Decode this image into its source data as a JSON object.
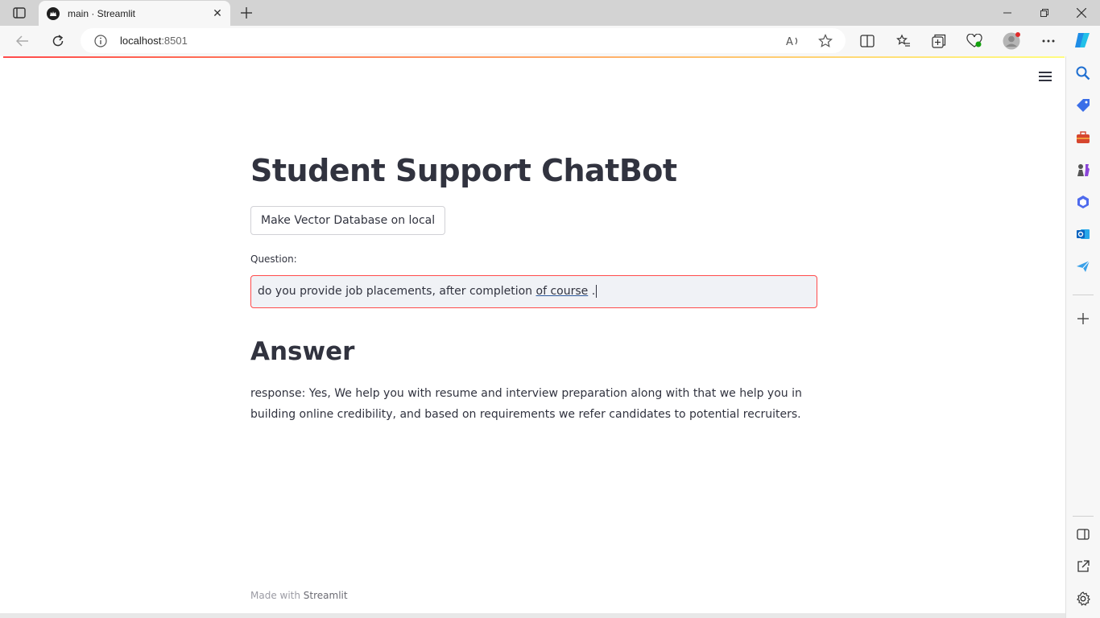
{
  "browser": {
    "tab_title": "main · Streamlit",
    "url_host": "localhost",
    "url_port": ":8501"
  },
  "app": {
    "title": "Student Support ChatBot",
    "vector_button": "Make Vector Database on local",
    "question_label": "Question:",
    "question_text_prefix": "do you provide job placements, after completion ",
    "question_text_underlined": "of course",
    "question_text_suffix": " .",
    "answer_heading": "Answer",
    "answer_text": "response: Yes, We help you with resume and interview preparation along with that we help you in building online credibility, and based on requirements we refer candidates to potential recruiters.",
    "footer_prefix": "Made with ",
    "footer_brand": "Streamlit"
  },
  "colors": {
    "primary": "#ff4b4b",
    "text": "#31333f",
    "input_bg": "#f0f2f6"
  }
}
